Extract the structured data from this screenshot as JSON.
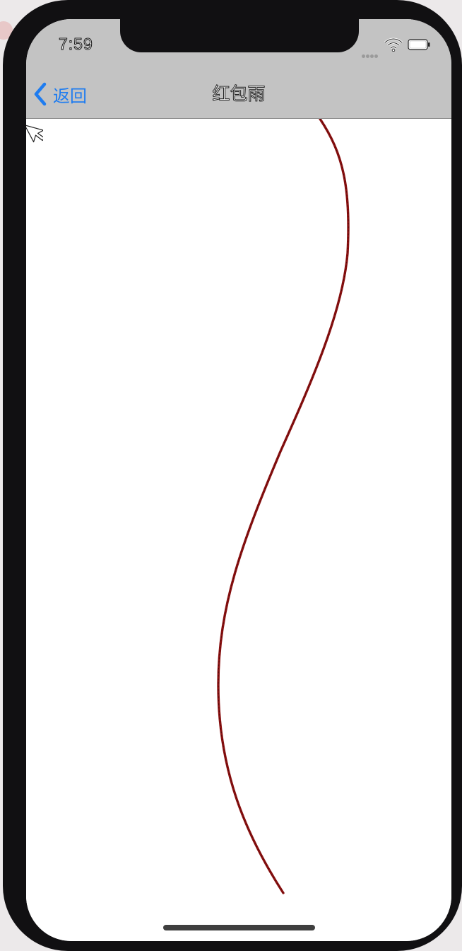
{
  "status_bar": {
    "time": "7:59",
    "icons": [
      "signal-dots-icon",
      "wifi-icon",
      "battery-icon"
    ]
  },
  "nav": {
    "back_label": "返回",
    "title": "红包雨"
  },
  "content": {
    "elements": [
      "red-envelope-trajectory-curve",
      "mouse-cursor-icon"
    ]
  },
  "colors": {
    "nav_background": "#c3c3c3",
    "back_tint": "#1e7cf0",
    "curve_stroke": "#8a1010",
    "device_frame": "#111012"
  }
}
